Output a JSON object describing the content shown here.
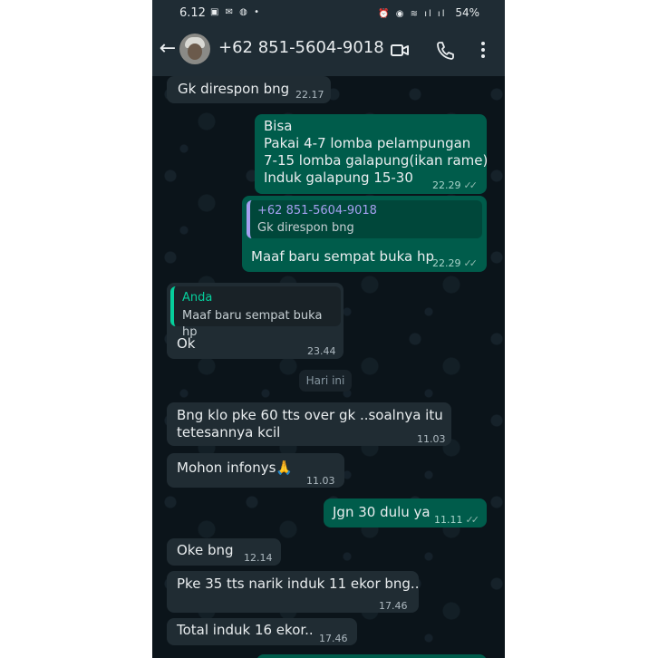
{
  "status_bar": {
    "time": "6.12",
    "icons_left": "▣ ✉ ◍ •",
    "icons_right": "⏰ ◉ ≋ ıl ıl",
    "battery": "54%"
  },
  "header": {
    "contact": "+62 851-5604-9018",
    "back_icon": "arrow-left-icon",
    "video_icon": "video-camera-icon",
    "call_icon": "phone-icon",
    "menu_icon": "more-vertical-icon"
  },
  "colors": {
    "incoming": "#202c33",
    "outgoing": "#005c4b",
    "quote_self": "#06cf9c",
    "quote_contact": "#a5a0f0"
  },
  "messages": [
    {
      "text": "Gk direspon bng",
      "time": "22.17"
    },
    {
      "lines": [
        "Bisa",
        "Pakai 4-7 lomba pelampungan",
        "7-15 lomba galapung(ikan rame)",
        "Induk galapung 15-30"
      ],
      "time": "22.29",
      "ticks": "✓✓"
    },
    {
      "quote_name": "+62 851-5604-9018",
      "quote_text": "Gk direspon bng",
      "text": "Maaf baru sempat buka hp",
      "time": "22.29",
      "ticks": "✓✓"
    },
    {
      "quote_name": "Anda",
      "quote_text": "Maaf baru sempat buka hp",
      "text": "Ok",
      "time": "23.44"
    },
    {
      "lines": [
        "Bng klo pke 60 tts over gk ..soalnya itu",
        "tetesannya kcil"
      ],
      "time": "11.03"
    },
    {
      "text": "Mohon infonys",
      "emoji": "🙏",
      "time": "11.03"
    },
    {
      "text": "Jgn 30 dulu ya",
      "time": "11.11",
      "ticks": "✓✓"
    },
    {
      "text": "Oke bng",
      "time": "12.14"
    },
    {
      "text": "Pke 35 tts narik induk 11 ekor bng..",
      "time": "17.46"
    },
    {
      "text": "Total induk 16 ekor..",
      "time": "17.46"
    }
  ],
  "date_separator": "Hari ini"
}
